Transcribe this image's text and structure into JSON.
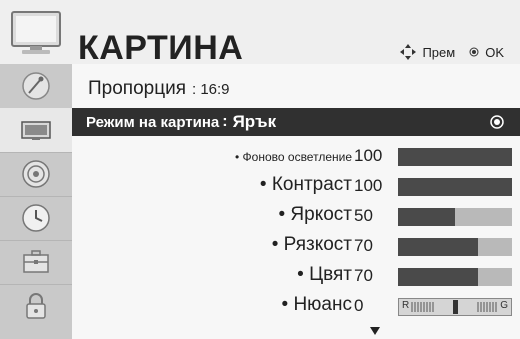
{
  "header": {
    "title": "КАРТИНА",
    "hint_move_label": "Прем",
    "hint_ok_label": "OK"
  },
  "sidebar": {
    "items": [
      {
        "icon": "satellite-dish-icon",
        "active": false
      },
      {
        "icon": "tv-picture-icon",
        "active": true
      },
      {
        "icon": "speaker-icon",
        "active": false
      },
      {
        "icon": "clock-icon",
        "active": false
      },
      {
        "icon": "toolbox-icon",
        "active": false
      },
      {
        "icon": "lock-icon",
        "active": false
      }
    ]
  },
  "menu": {
    "aspect": {
      "label": "Пропорция",
      "value": ": 16:9"
    },
    "picture_mode": {
      "label": "Режим на картина",
      "colon": ":",
      "value": "Ярък"
    },
    "settings": [
      {
        "label": "• Фоново осветление",
        "value": "100",
        "level": 1.0
      },
      {
        "label": "• Контраст",
        "value": "100",
        "level": 1.0
      },
      {
        "label": "• Яркост",
        "value": "50",
        "level": 0.5
      },
      {
        "label": "• Рязкост",
        "value": "70",
        "level": 0.7
      },
      {
        "label": "• Цвят",
        "value": "70",
        "level": 0.7
      },
      {
        "label": "• Нюанс",
        "value": "0",
        "level": 0.5
      }
    ],
    "tint_left": "R",
    "tint_right": "G"
  },
  "colors": {
    "selected_row_bg": "#303030",
    "bar_fill": "#4a4a4a",
    "bar_track": "#b9b9b9",
    "sidebar_bg": "#c9c9c9"
  }
}
